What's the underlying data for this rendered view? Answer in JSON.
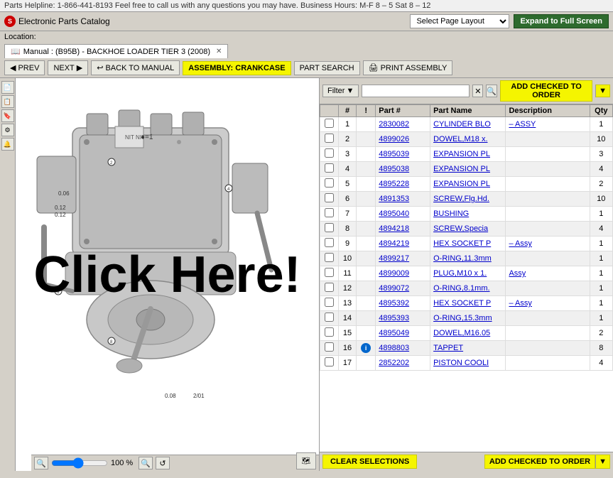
{
  "helpline": {
    "text": "Parts Helpline: 1-866-441-8193 Feel free to call us with any questions you may have. Business Hours: M-F 8 – 5 Sat 8 – 12"
  },
  "app": {
    "title": "Electronic Parts Catalog",
    "page_layout_placeholder": "Select Page Layout",
    "expand_btn": "Expand to Full Screen"
  },
  "location": {
    "label": "Location:"
  },
  "manual_tab": {
    "label": "Manual : (B95B) - BACKHOE LOADER TIER 3 (2008)"
  },
  "toolbar": {
    "prev": "PREV",
    "next": "NEXT",
    "back_to_manual": "BACK TO MANUAL",
    "assembly_label": "ASSEMBLY: CRANKCASE",
    "part_search": "PART SEARCH",
    "print_assembly": "PRINT ASSEMBLY"
  },
  "filter_bar": {
    "filter_label": "Filter",
    "filter_dropdown": "▼",
    "clear_icon": "✕",
    "search_icon": "🔍",
    "add_checked_btn": "ADD CHECKED TO ORDER",
    "add_checked_dropdown": "▼"
  },
  "table": {
    "headers": [
      "",
      "#",
      "!",
      "Part #",
      "Part Name",
      "Description",
      "Qty"
    ],
    "rows": [
      {
        "num": "1",
        "bang": "",
        "part_num": "2830082",
        "part_name": "CYLINDER BLO",
        "description": "– ASSY",
        "qty": "1"
      },
      {
        "num": "2",
        "bang": "",
        "part_num": "4899026",
        "part_name": "DOWEL,M18 x.",
        "description": "",
        "qty": "10"
      },
      {
        "num": "3",
        "bang": "",
        "part_num": "4895039",
        "part_name": "EXPANSION PL",
        "description": "",
        "qty": "3"
      },
      {
        "num": "4",
        "bang": "",
        "part_num": "4895038",
        "part_name": "EXPANSION PL",
        "description": "",
        "qty": "4"
      },
      {
        "num": "5",
        "bang": "",
        "part_num": "4895228",
        "part_name": "EXPANSION PL",
        "description": "",
        "qty": "2"
      },
      {
        "num": "6",
        "bang": "",
        "part_num": "4891353",
        "part_name": "SCREW,Flg.Hd.",
        "description": "",
        "qty": "10"
      },
      {
        "num": "7",
        "bang": "",
        "part_num": "4895040",
        "part_name": "BUSHING",
        "description": "",
        "qty": "1"
      },
      {
        "num": "8",
        "bang": "",
        "part_num": "4894218",
        "part_name": "SCREW,Specia",
        "description": "",
        "qty": "4"
      },
      {
        "num": "9",
        "bang": "",
        "part_num": "4894219",
        "part_name": "HEX SOCKET P",
        "description": "– Assy",
        "qty": "1"
      },
      {
        "num": "10",
        "bang": "",
        "part_num": "4899217",
        "part_name": "O-RING,11.3mm",
        "description": "",
        "qty": "1"
      },
      {
        "num": "11",
        "bang": "",
        "part_num": "4899009",
        "part_name": "PLUG,M10 x 1.",
        "description": "Assy",
        "qty": "1"
      },
      {
        "num": "12",
        "bang": "",
        "part_num": "4899072",
        "part_name": "O-RING,8.1mm.",
        "description": "",
        "qty": "1"
      },
      {
        "num": "13",
        "bang": "",
        "part_num": "4895392",
        "part_name": "HEX SOCKET P",
        "description": "– Assy",
        "qty": "1"
      },
      {
        "num": "14",
        "bang": "",
        "part_num": "4895393",
        "part_name": "O-RING,15.3mm",
        "description": "",
        "qty": "1"
      },
      {
        "num": "15",
        "bang": "",
        "part_num": "4895049",
        "part_name": "DOWEL,M16.05",
        "description": "",
        "qty": "2"
      },
      {
        "num": "16",
        "bang": "info",
        "part_num": "4898803",
        "part_name": "TAPPET",
        "description": "",
        "qty": "8"
      },
      {
        "num": "17",
        "bang": "",
        "part_num": "2852202",
        "part_name": "PISTON COOLI",
        "description": "",
        "qty": "4"
      }
    ]
  },
  "bottom_bar": {
    "clear_btn": "CLEAR SELECTIONS",
    "add_order_btn": "ADD CHECKED TO ORDER",
    "add_order_dd": "▼"
  },
  "image_panel": {
    "zoom_pct": "100 %",
    "click_here": "Click Here!"
  },
  "side_icons": [
    "📄",
    "📋",
    "🔖",
    "⚙",
    "🔔"
  ]
}
